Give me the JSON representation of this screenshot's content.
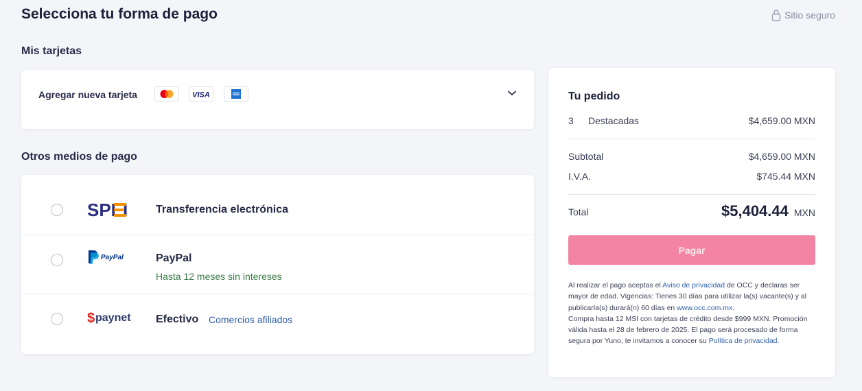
{
  "header": {
    "title": "Selecciona tu forma de pago",
    "secure_label": "Sitio seguro"
  },
  "cards": {
    "section_label": "Mis tarjetas",
    "add_new_label": "Agregar nueva tarjeta",
    "brands": [
      "mastercard-icon",
      "visa-icon",
      "amex-icon"
    ],
    "visa_text": "VISA"
  },
  "others": {
    "section_label": "Otros medios de pago",
    "spei": {
      "name": "Transferencia electrónica",
      "logo_text": "SPEI"
    },
    "paypal": {
      "name": "PayPal",
      "sub": "Hasta 12 meses sin intereses",
      "logo_text": "PayPal"
    },
    "paynet": {
      "name": "Efectivo",
      "link": "Comercios afiliados",
      "logo_text": "paynet"
    }
  },
  "order": {
    "title": "Tu pedido",
    "item_qty": "3",
    "item_name": "Destacadas",
    "item_price": "$4,659.00 MXN",
    "subtotal_label": "Subtotal",
    "subtotal_value": "$4,659.00 MXN",
    "iva_label": "I.V.A.",
    "iva_value": "$745.44 MXN",
    "total_label": "Total",
    "total_amount": "$5,404.44",
    "total_currency": "MXN",
    "pay_button": "Pagar"
  },
  "legal": {
    "p1": "Al realizar el pago aceptas el ",
    "privacy_link": "Aviso de privacidad",
    "p2": " de OCC y declaras ser mayor de edad. Vigencias: Tienes 30 días para utilizar la(s) vacante(s) y al publicarla(s) durará(n) 60 días en ",
    "site_link": "www.occ.com.mx",
    "p3": ".",
    "p4": "Compra hasta 12 MSI con tarjetas de crédito desde $999 MXN. Promoción válida hasta el 28 de febrero de 2025. El pago será procesado de forma segura por Yuno, te invitamos a conocer su ",
    "policy_link": "Política de privacidad",
    "p5": "."
  },
  "colors": {
    "accent_pink": "#f484a4",
    "link_blue": "#2f5fa8",
    "green": "#3a7a45",
    "spei_navy": "#2b2f83",
    "spei_orange": "#f39200",
    "paynet_red": "#e2231a"
  }
}
